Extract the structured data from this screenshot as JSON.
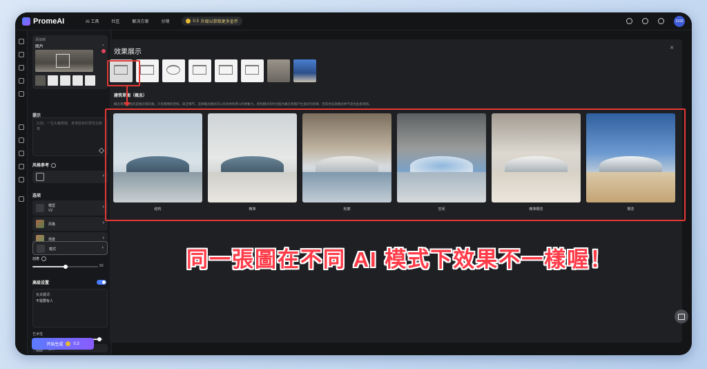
{
  "topbar": {
    "brand": "PromeAI",
    "nav": [
      "AI 工具",
      "社区",
      "解决方案",
      "分销"
    ],
    "promo_value": "0.3",
    "promo_text": "升级以获取更多金币",
    "avatar_text": "3166"
  },
  "left_panel": {
    "source_label": "添加到",
    "source_value": "图片",
    "prompt_title": "提示",
    "prompt_placeholder": "比如：一位头戴眼镜、身穿蓝色的男性在跳舞",
    "style_title": "风格参考",
    "options_title": "选项",
    "options": [
      {
        "label": "模型",
        "value": "V2"
      },
      {
        "label": "风格",
        "value": ""
      },
      {
        "label": "场景",
        "value": ""
      },
      {
        "label": "模式",
        "value": ""
      }
    ],
    "strength_label": "创意",
    "strength_value": "50",
    "strength_fraction": 0.5,
    "advanced_title": "高级设置",
    "negative_label": "负关键词",
    "negative_value": "不需要有人",
    "art_label": "艺术性",
    "art_fraction": 0.95,
    "last_row_label": "图像",
    "generate_label": "开始生成",
    "generate_cost": "0.3"
  },
  "modal": {
    "title": "效果展示",
    "close_label": "×",
    "category_title": "建筑草图（概念）",
    "category_desc": "概念草图描绘的是概念和轮廓。只有粗略的结构，缺乏细节。选择概念模式可以有效地利用AI的想象力，结构模式有时也能为概念草图产生良好的效果，而其他渲染模式并不适合此类草图。",
    "results": [
      {
        "label": "结构"
      },
      {
        "label": "精准"
      },
      {
        "label": "轮廓"
      },
      {
        "label": "空间"
      },
      {
        "label": "精准概念"
      },
      {
        "label": "概念"
      }
    ]
  },
  "caption": "同一張圖在不同 AI 模式下效果不一樣喔！",
  "colors": {
    "accent": "#4a7cff",
    "annotation_red": "#e53935",
    "caption_red": "#ff3b48"
  }
}
